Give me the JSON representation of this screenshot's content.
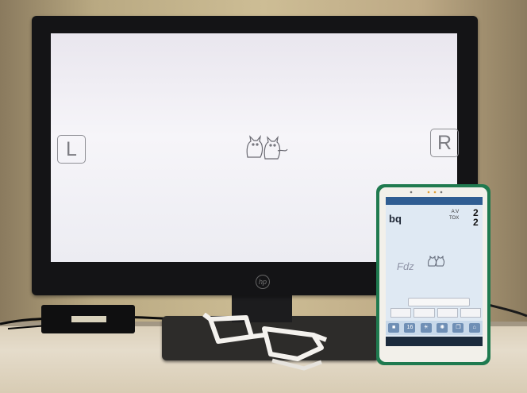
{
  "monitor": {
    "left_marker": "L",
    "right_marker": "R",
    "logo": "hp"
  },
  "tablet": {
    "app_logo": "bq",
    "readout_line1": "A:V",
    "readout_line2": "TOX",
    "digit_top": "2",
    "digit_bottom": "2",
    "target_text": "Fdz",
    "toolbar_value": "16",
    "toolbar_icons": [
      "square-icon",
      "sun-icon",
      "brightness-icon",
      "ac-icon",
      "copy-icon",
      "home-icon"
    ]
  },
  "colors": {
    "tablet_frame": "#1f7a4f",
    "tablet_statusbar": "#2f5d92",
    "monitor_bezel": "#141416"
  }
}
